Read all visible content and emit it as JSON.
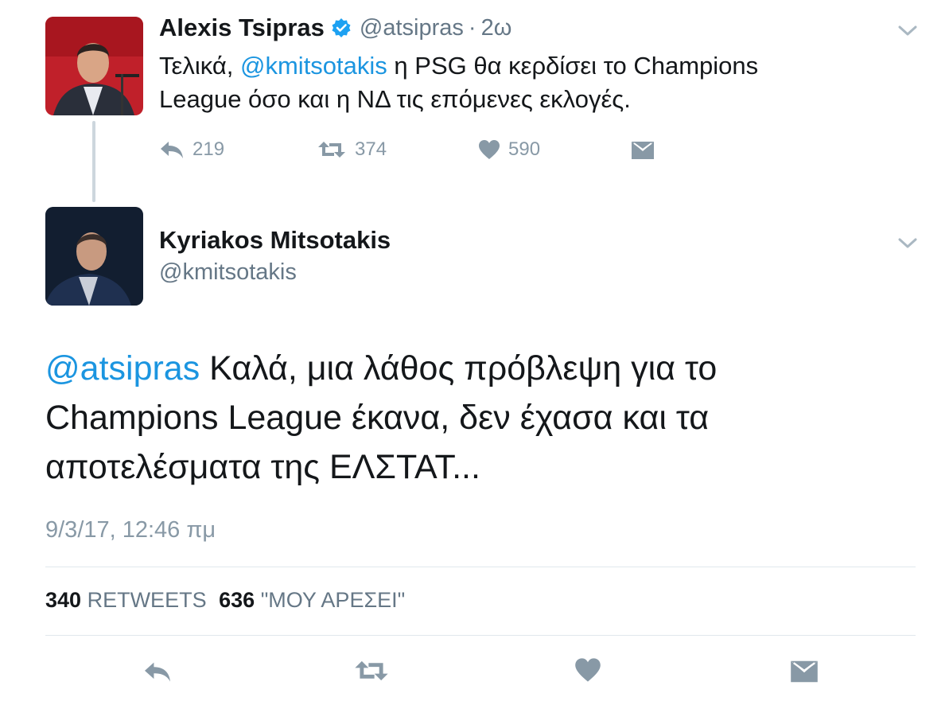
{
  "tweet1": {
    "name": "Alexis Tsipras",
    "handle": "@atsipras",
    "separator": "·",
    "time": "2ω",
    "text_part1": "Τελικά, ",
    "mention": "@kmitsotakis",
    "text_part2": " η PSG θα κερδίσει το Champions",
    "text_line2": "League όσο και η ΝΔ τις επόμενες εκλογές.",
    "reply_count": "219",
    "retweet_count": "374",
    "like_count": "590",
    "verified": true
  },
  "tweet2": {
    "name": "Kyriakos Mitsotakis",
    "handle": "@kmitsotakis",
    "mention": "@atsipras",
    "text_line1_rest": " Καλά, μια λάθος πρόβλεψη για το",
    "text_line2": "Champions League έκανα, δεν έχασα και τα",
    "text_line3": "αποτελέσματα της ΕΛΣΤΑΤ...",
    "timestamp": "9/3/17, 12:46 πμ",
    "retweets_count": "340",
    "retweets_label": "RETWEETS",
    "likes_count": "636",
    "likes_label": "\"ΜΟΥ ΑΡΕΣΕΙ\""
  },
  "colors": {
    "link": "#1b95e0",
    "muted": "#8899a6",
    "text": "#14171a",
    "verified": "#1da1f2"
  },
  "icons": [
    "verified-badge-icon",
    "chevron-down-icon",
    "reply-icon",
    "retweet-icon",
    "like-heart-icon",
    "direct-message-icon"
  ]
}
